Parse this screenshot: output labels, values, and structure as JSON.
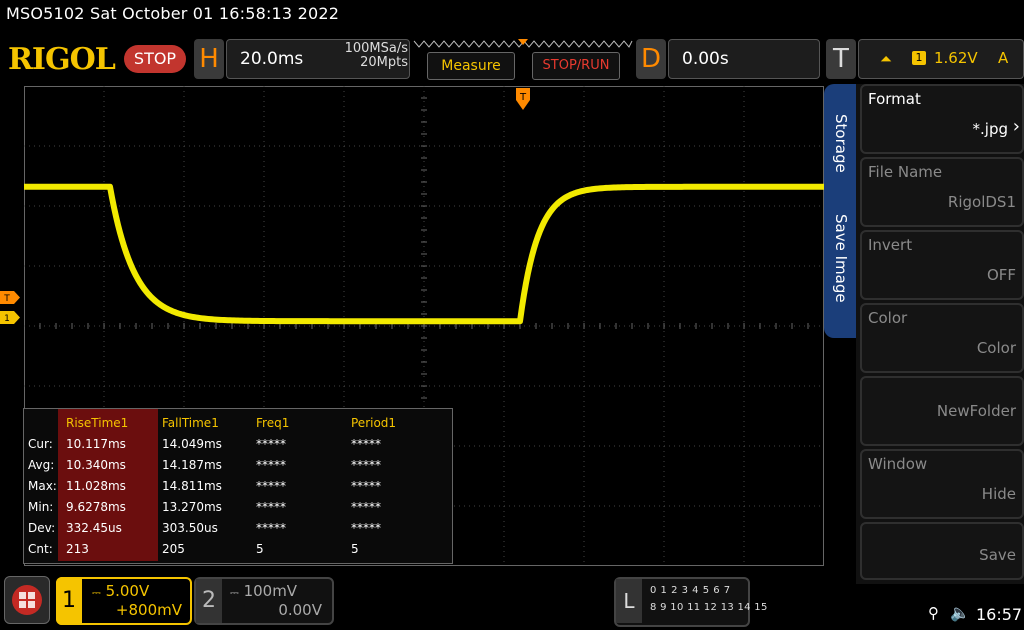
{
  "top": {
    "title": "MSO5102  Sat October 01 16:58:13 2022"
  },
  "header": {
    "logo": "RIGOL",
    "run_state": "STOP",
    "horizontal": {
      "letter": "H",
      "timebase": "20.0ms",
      "sample_rate": "100MSa/s",
      "memory_depth": "20Mpts"
    },
    "measure_label": "Measure",
    "stoprun_label": "STOP/RUN",
    "delay": {
      "letter": "D",
      "value": "0.00s"
    },
    "trigger": {
      "letter": "T",
      "channel": "1",
      "level": "1.62V",
      "mode": "A"
    }
  },
  "markers": {
    "trigger_position": "T",
    "trigger_level": "T",
    "channel1": "1"
  },
  "measurements": {
    "headers": [
      "RiseTime1",
      "FallTime1",
      "Freq1",
      "Period1"
    ],
    "rows": [
      {
        "label": "Cur:",
        "values": [
          "10.117ms",
          "14.049ms",
          "*****",
          "*****"
        ]
      },
      {
        "label": "Avg:",
        "values": [
          "10.340ms",
          "14.187ms",
          "*****",
          "*****"
        ]
      },
      {
        "label": "Max:",
        "values": [
          "11.028ms",
          "14.811ms",
          "*****",
          "*****"
        ]
      },
      {
        "label": "Min:",
        "values": [
          "9.6278ms",
          "13.270ms",
          "*****",
          "*****"
        ]
      },
      {
        "label": "Dev:",
        "values": [
          "332.45us",
          "303.50us",
          "*****",
          "*****"
        ]
      },
      {
        "label": "Cnt:",
        "values": [
          "213",
          "205",
          "5",
          "5"
        ]
      }
    ]
  },
  "sidebar": {
    "tabs": [
      "Storage",
      "Save Image"
    ],
    "keys": [
      {
        "title": "Format",
        "value": "*.jpg"
      },
      {
        "title": "File Name",
        "value": "RigolDS1"
      },
      {
        "title": "Invert",
        "value": "OFF"
      },
      {
        "title": "Color",
        "value": "Color"
      },
      {
        "title": "",
        "value": "NewFolder"
      },
      {
        "title": "Window",
        "value": "Hide"
      },
      {
        "title": "",
        "value": "Save"
      }
    ]
  },
  "channels": {
    "ch1": {
      "number": "1",
      "scale": "5.00V",
      "offset": "+800mV",
      "color": "#f5c400"
    },
    "ch2": {
      "number": "2",
      "scale": "100mV",
      "offset": "0.00V"
    }
  },
  "logic_analyzer": {
    "letter": "L",
    "row1": "0 1 2 3   4 5 6 7",
    "row2": "8 9 10 11  12 13 14 15"
  },
  "status": {
    "time": "16:57"
  },
  "waveform": {
    "color": "#f2ea00",
    "high_level_fraction": 0.21,
    "low_level_fraction": 0.49
  }
}
